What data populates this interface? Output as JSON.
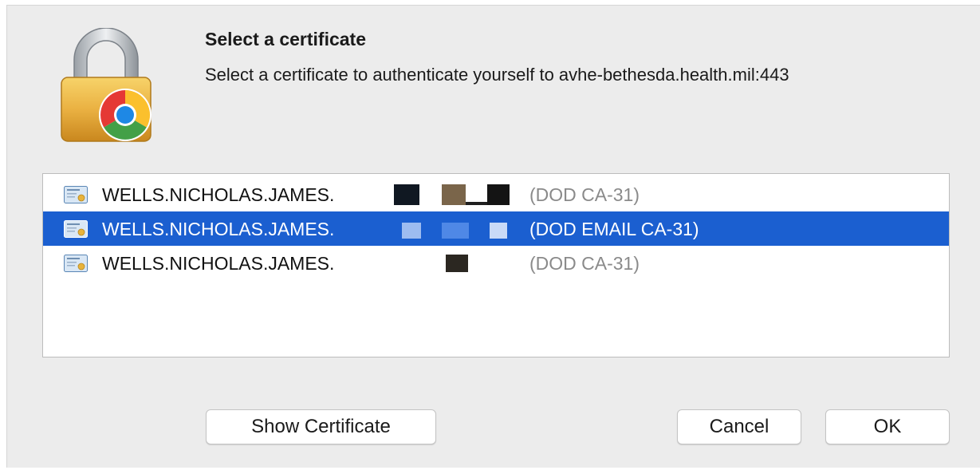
{
  "dialog": {
    "title": "Select a certificate",
    "message": "Select a certificate to authenticate yourself to avhe-bethesda.health.mil:443",
    "lock_icon": "padlock-with-chrome-icon"
  },
  "certificates": [
    {
      "name": "WELLS.NICHOLAS.JAMES.",
      "issuer": "(DOD CA-31)",
      "selected": false,
      "icon": "certificate-icon"
    },
    {
      "name": "WELLS.NICHOLAS.JAMES.",
      "issuer": "(DOD EMAIL CA-31)",
      "selected": true,
      "icon": "certificate-icon"
    },
    {
      "name": "WELLS.NICHOLAS.JAMES.",
      "issuer": "(DOD CA-31)",
      "selected": false,
      "icon": "certificate-icon"
    }
  ],
  "buttons": {
    "show_certificate": "Show Certificate",
    "cancel": "Cancel",
    "ok": "OK"
  },
  "colors": {
    "selection": "#1b5fd0",
    "dialog_bg": "#ececec",
    "issuer_text": "#8a8a8a"
  }
}
